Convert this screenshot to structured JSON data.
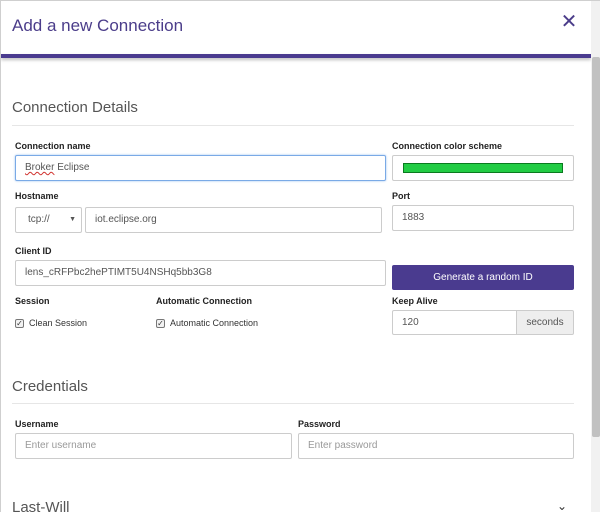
{
  "dialog": {
    "title": "Add a new Connection",
    "close_icon": "close-icon",
    "accent_color": "#4a3b8f"
  },
  "connection_details": {
    "title": "Connection Details",
    "name_label": "Connection name",
    "name_value_misspelled": "Broker",
    "name_value_rest": " Eclipse",
    "color_label": "Connection color scheme",
    "color_value": "#22cc44",
    "hostname_label": "Hostname",
    "protocol": "tcp://",
    "host": "iot.eclipse.org",
    "port_label": "Port",
    "port": "1883",
    "client_id_label": "Client ID",
    "client_id": "lens_cRFPbc2hePTIMT5U4NSHq5bb3G8",
    "generate_button": "Generate a random ID",
    "session_label": "Session",
    "clean_session": "Clean Session",
    "auto_connection_label": "Automatic Connection",
    "auto_connection": "Automatic Connection",
    "keep_alive_label": "Keep Alive",
    "keep_alive": "120",
    "keep_alive_unit": "seconds"
  },
  "credentials": {
    "title": "Credentials",
    "username_label": "Username",
    "username_placeholder": "Enter username",
    "password_label": "Password",
    "password_placeholder": "Enter password"
  },
  "last_will": {
    "title": "Last-Will",
    "expand_icon": "chevron-down-icon"
  }
}
